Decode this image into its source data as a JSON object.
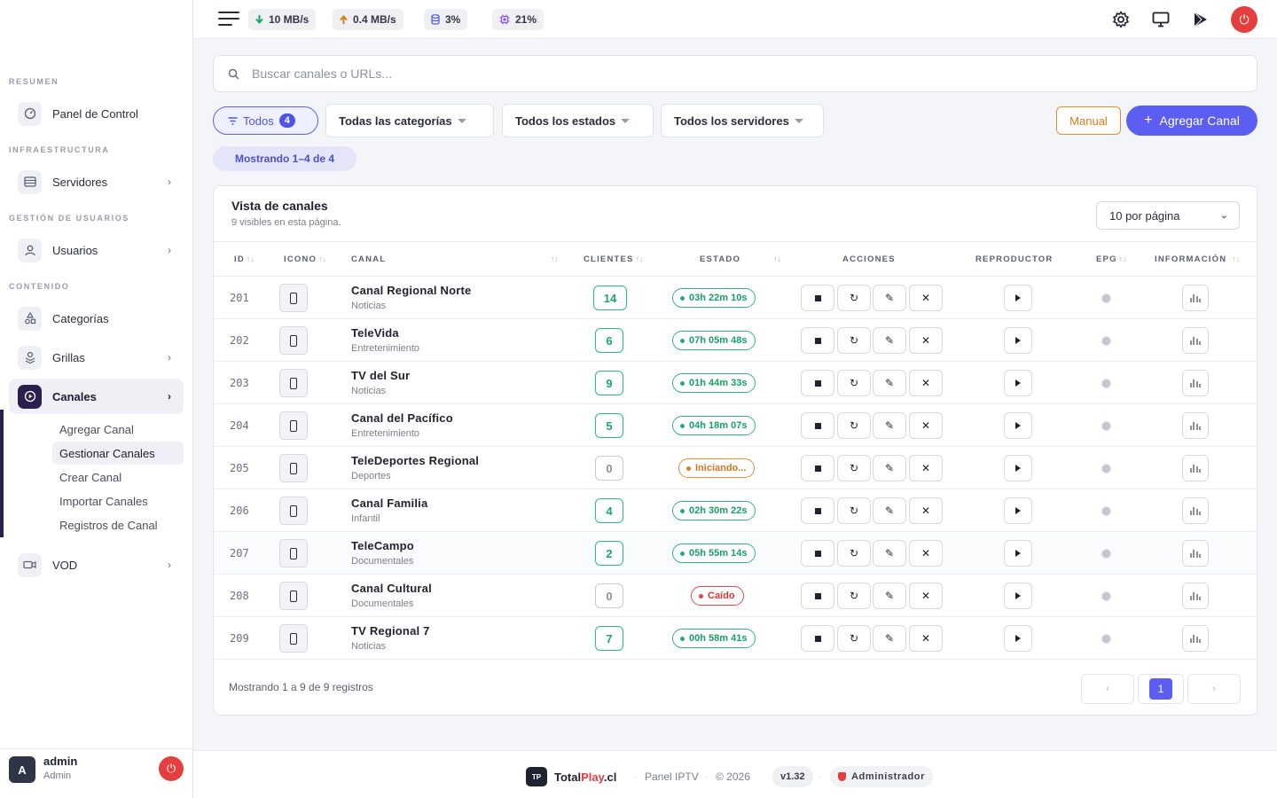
{
  "sidebar": {
    "sections": {
      "resumen": "RESUMEN",
      "infraestructura": "INFRAESTRUCTURA",
      "gestion": "GESTIÓN DE USUARIOS",
      "contenido": "CONTENIDO"
    },
    "items": {
      "panel": "Panel de Control",
      "servidores": "Servidores",
      "usuarios": "Usuarios",
      "categorias": "Categorías",
      "grillas": "Grillas",
      "canales": "Canales",
      "vod": "VOD"
    },
    "canales_sub": [
      "Agregar Canal",
      "Gestionar Canales",
      "Crear Canal",
      "Importar Canales",
      "Registros de Canal"
    ],
    "user": {
      "initial": "A",
      "name": "admin",
      "role": "Admin"
    }
  },
  "topbar": {
    "download": "10 MB/s",
    "upload": "0.4 MB/s",
    "disk": "3%",
    "cpu": "21%"
  },
  "search": {
    "placeholder": "Buscar canales o URLs..."
  },
  "filters": {
    "all_label": "Todos",
    "all_count": "4",
    "categories": "Todas las categorías",
    "states": "Todos los estados",
    "servers": "Todos los servidores",
    "manual": "Manual",
    "add_channel": "Agregar Canal",
    "showing": "Mostrando 1–4 de 4"
  },
  "card": {
    "title": "Vista de canales",
    "subtitle": "9 visibles en esta página.",
    "per_page": "10 por página"
  },
  "columns": {
    "id": "ID",
    "icon": "ICONO",
    "channel": "CANAL",
    "clients": "CLIENTES",
    "status": "ESTADO",
    "actions": "ACCIONES",
    "player": "REPRODUCTOR",
    "epg": "EPG",
    "info": "INFORMACIÓN"
  },
  "rows": [
    {
      "id": "201",
      "name": "Canal Regional Norte",
      "category": "Noticias",
      "clients": "14",
      "status": "03h 22m 10s",
      "state": "online"
    },
    {
      "id": "202",
      "name": "TeleVida",
      "category": "Entretenimiento",
      "clients": "6",
      "status": "07h 05m 48s",
      "state": "online"
    },
    {
      "id": "203",
      "name": "TV del Sur",
      "category": "Noticias",
      "clients": "9",
      "status": "01h 44m 33s",
      "state": "online"
    },
    {
      "id": "204",
      "name": "Canal del Pacífico",
      "category": "Entretenimiento",
      "clients": "5",
      "status": "04h 18m 07s",
      "state": "online"
    },
    {
      "id": "205",
      "name": "TeleDeportes Regional",
      "category": "Deportes",
      "clients": "0",
      "status": "Iniciando...",
      "state": "starting"
    },
    {
      "id": "206",
      "name": "Canal Familia",
      "category": "Infantil",
      "clients": "4",
      "status": "02h 30m 22s",
      "state": "online"
    },
    {
      "id": "207",
      "name": "TeleCampo",
      "category": "Documentales",
      "clients": "2",
      "status": "05h 55m 14s",
      "state": "online"
    },
    {
      "id": "208",
      "name": "Canal Cultural",
      "category": "Documentales",
      "clients": "0",
      "status": "Caído",
      "state": "down"
    },
    {
      "id": "209",
      "name": "TV Regional 7",
      "category": "Noticias",
      "clients": "7",
      "status": "00h 58m 41s",
      "state": "online"
    }
  ],
  "table_footer": {
    "text": "Mostrando 1 a 9 de 9 registros",
    "prev": "‹",
    "page": "1",
    "next": "›"
  },
  "footer": {
    "logo": "TP",
    "brand_a": "Total",
    "brand_b": "Play",
    "brand_c": ".cl",
    "panel": "Panel IPTV",
    "year": "© 2026",
    "version": "v1.32",
    "role": "Administrador"
  },
  "colors": {
    "accent": "#5b5ef0",
    "online": "#1fb171",
    "starting": "#e07b18",
    "down": "#e04848",
    "power": "#e53e3e"
  }
}
